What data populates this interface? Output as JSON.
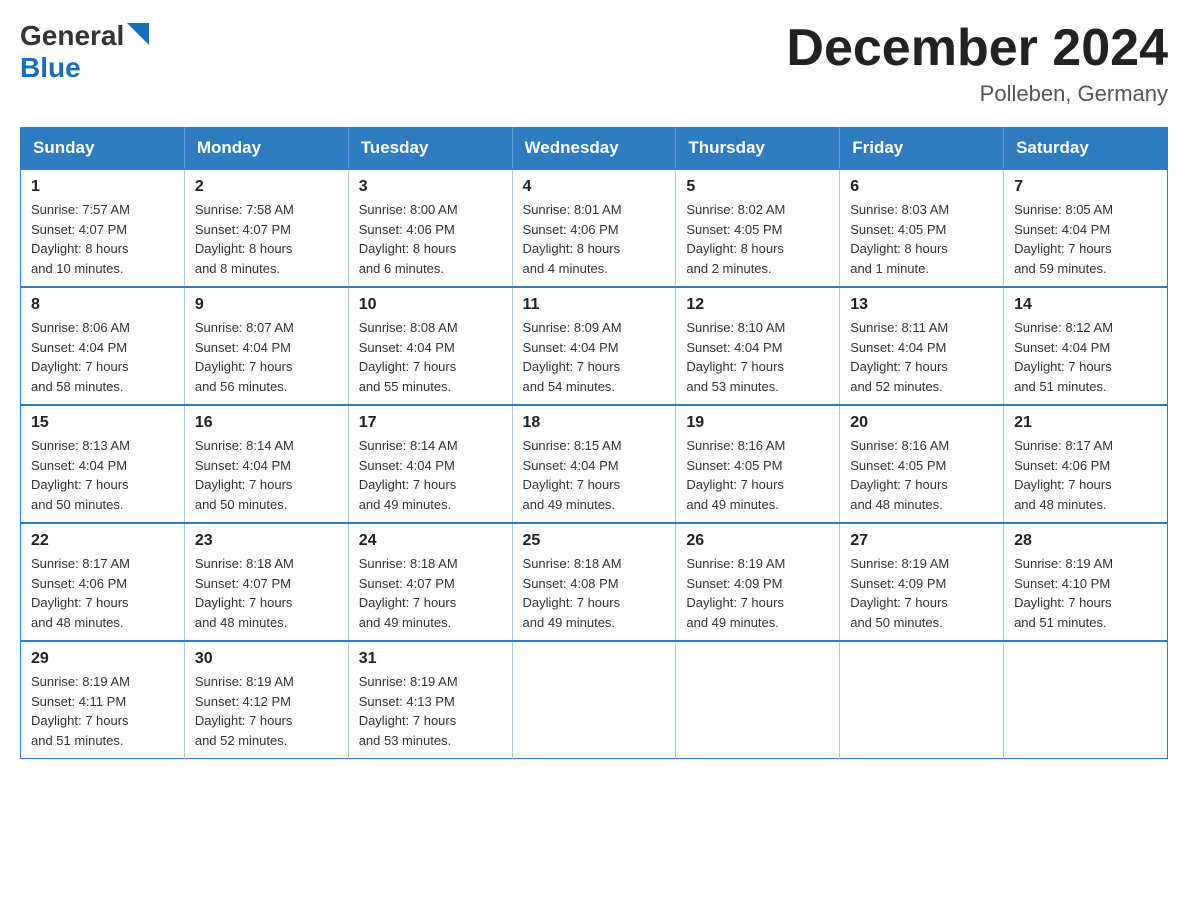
{
  "header": {
    "logo_general": "General",
    "logo_blue": "Blue",
    "title": "December 2024",
    "subtitle": "Polleben, Germany"
  },
  "weekdays": [
    "Sunday",
    "Monday",
    "Tuesday",
    "Wednesday",
    "Thursday",
    "Friday",
    "Saturday"
  ],
  "weeks": [
    [
      {
        "day": "1",
        "info": "Sunrise: 7:57 AM\nSunset: 4:07 PM\nDaylight: 8 hours\nand 10 minutes."
      },
      {
        "day": "2",
        "info": "Sunrise: 7:58 AM\nSunset: 4:07 PM\nDaylight: 8 hours\nand 8 minutes."
      },
      {
        "day": "3",
        "info": "Sunrise: 8:00 AM\nSunset: 4:06 PM\nDaylight: 8 hours\nand 6 minutes."
      },
      {
        "day": "4",
        "info": "Sunrise: 8:01 AM\nSunset: 4:06 PM\nDaylight: 8 hours\nand 4 minutes."
      },
      {
        "day": "5",
        "info": "Sunrise: 8:02 AM\nSunset: 4:05 PM\nDaylight: 8 hours\nand 2 minutes."
      },
      {
        "day": "6",
        "info": "Sunrise: 8:03 AM\nSunset: 4:05 PM\nDaylight: 8 hours\nand 1 minute."
      },
      {
        "day": "7",
        "info": "Sunrise: 8:05 AM\nSunset: 4:04 PM\nDaylight: 7 hours\nand 59 minutes."
      }
    ],
    [
      {
        "day": "8",
        "info": "Sunrise: 8:06 AM\nSunset: 4:04 PM\nDaylight: 7 hours\nand 58 minutes."
      },
      {
        "day": "9",
        "info": "Sunrise: 8:07 AM\nSunset: 4:04 PM\nDaylight: 7 hours\nand 56 minutes."
      },
      {
        "day": "10",
        "info": "Sunrise: 8:08 AM\nSunset: 4:04 PM\nDaylight: 7 hours\nand 55 minutes."
      },
      {
        "day": "11",
        "info": "Sunrise: 8:09 AM\nSunset: 4:04 PM\nDaylight: 7 hours\nand 54 minutes."
      },
      {
        "day": "12",
        "info": "Sunrise: 8:10 AM\nSunset: 4:04 PM\nDaylight: 7 hours\nand 53 minutes."
      },
      {
        "day": "13",
        "info": "Sunrise: 8:11 AM\nSunset: 4:04 PM\nDaylight: 7 hours\nand 52 minutes."
      },
      {
        "day": "14",
        "info": "Sunrise: 8:12 AM\nSunset: 4:04 PM\nDaylight: 7 hours\nand 51 minutes."
      }
    ],
    [
      {
        "day": "15",
        "info": "Sunrise: 8:13 AM\nSunset: 4:04 PM\nDaylight: 7 hours\nand 50 minutes."
      },
      {
        "day": "16",
        "info": "Sunrise: 8:14 AM\nSunset: 4:04 PM\nDaylight: 7 hours\nand 50 minutes."
      },
      {
        "day": "17",
        "info": "Sunrise: 8:14 AM\nSunset: 4:04 PM\nDaylight: 7 hours\nand 49 minutes."
      },
      {
        "day": "18",
        "info": "Sunrise: 8:15 AM\nSunset: 4:04 PM\nDaylight: 7 hours\nand 49 minutes."
      },
      {
        "day": "19",
        "info": "Sunrise: 8:16 AM\nSunset: 4:05 PM\nDaylight: 7 hours\nand 49 minutes."
      },
      {
        "day": "20",
        "info": "Sunrise: 8:16 AM\nSunset: 4:05 PM\nDaylight: 7 hours\nand 48 minutes."
      },
      {
        "day": "21",
        "info": "Sunrise: 8:17 AM\nSunset: 4:06 PM\nDaylight: 7 hours\nand 48 minutes."
      }
    ],
    [
      {
        "day": "22",
        "info": "Sunrise: 8:17 AM\nSunset: 4:06 PM\nDaylight: 7 hours\nand 48 minutes."
      },
      {
        "day": "23",
        "info": "Sunrise: 8:18 AM\nSunset: 4:07 PM\nDaylight: 7 hours\nand 48 minutes."
      },
      {
        "day": "24",
        "info": "Sunrise: 8:18 AM\nSunset: 4:07 PM\nDaylight: 7 hours\nand 49 minutes."
      },
      {
        "day": "25",
        "info": "Sunrise: 8:18 AM\nSunset: 4:08 PM\nDaylight: 7 hours\nand 49 minutes."
      },
      {
        "day": "26",
        "info": "Sunrise: 8:19 AM\nSunset: 4:09 PM\nDaylight: 7 hours\nand 49 minutes."
      },
      {
        "day": "27",
        "info": "Sunrise: 8:19 AM\nSunset: 4:09 PM\nDaylight: 7 hours\nand 50 minutes."
      },
      {
        "day": "28",
        "info": "Sunrise: 8:19 AM\nSunset: 4:10 PM\nDaylight: 7 hours\nand 51 minutes."
      }
    ],
    [
      {
        "day": "29",
        "info": "Sunrise: 8:19 AM\nSunset: 4:11 PM\nDaylight: 7 hours\nand 51 minutes."
      },
      {
        "day": "30",
        "info": "Sunrise: 8:19 AM\nSunset: 4:12 PM\nDaylight: 7 hours\nand 52 minutes."
      },
      {
        "day": "31",
        "info": "Sunrise: 8:19 AM\nSunset: 4:13 PM\nDaylight: 7 hours\nand 53 minutes."
      },
      {
        "day": "",
        "info": ""
      },
      {
        "day": "",
        "info": ""
      },
      {
        "day": "",
        "info": ""
      },
      {
        "day": "",
        "info": ""
      }
    ]
  ]
}
